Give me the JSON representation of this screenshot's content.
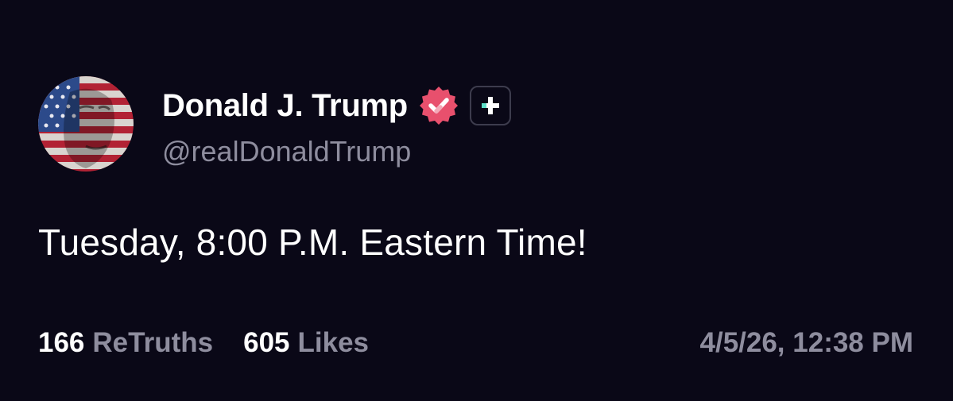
{
  "author": {
    "display_name": "Donald J. Trump",
    "handle": "@realDonaldTrump",
    "avatar_icon": "flag-portrait-avatar",
    "verified_icon": "verified-badge-icon",
    "plus_icon": "truth-plus-icon"
  },
  "post": {
    "text": "Tuesday, 8:00 P.M. Eastern Time!"
  },
  "stats": {
    "retruths_count": "166",
    "retruths_label": "ReTruths",
    "likes_count": "605",
    "likes_label": "Likes",
    "timestamp": "4/5/26, 12:38 PM"
  },
  "colors": {
    "background": "#0a0817",
    "primary_text": "#ffffff",
    "secondary_text": "#8e8d9e",
    "verified": "#e8506d",
    "plus_accent": "#5ee0c8"
  }
}
